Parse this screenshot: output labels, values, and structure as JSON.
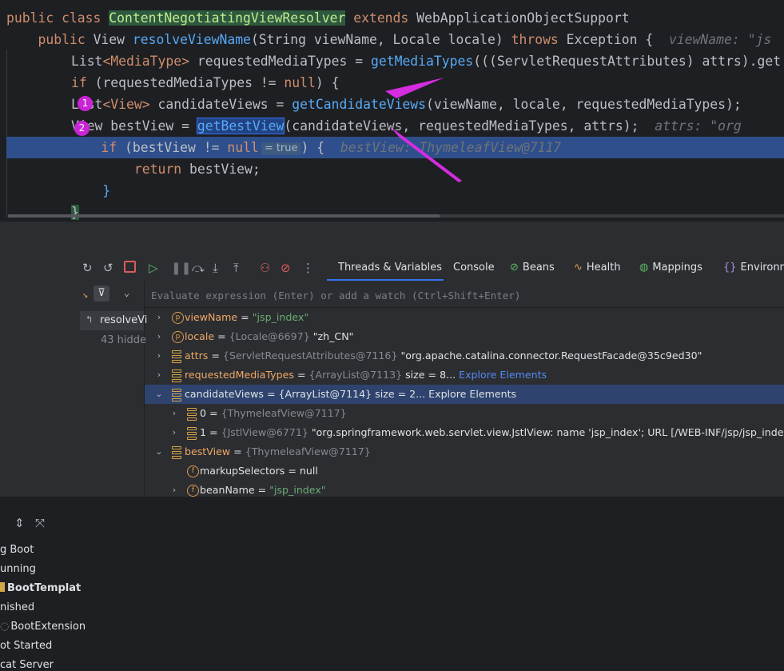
{
  "editor": {
    "line1": {
      "kw1": "public class ",
      "cls": "ContentNegotiatingViewResolver",
      "kw2": " extends ",
      "rest": "WebApplicationObjectSupport"
    },
    "line2": {
      "indent": "    ",
      "kw1": "public ",
      "type": "View ",
      "fn": "resolveViewName",
      "params": "(String viewName, Locale locale) ",
      "kw2": "throws ",
      "rest": "Exception { ",
      "hint": " viewName: \"js"
    },
    "line3": {
      "indent": "        ",
      "a": "List",
      "b": "<MediaType>",
      "c": " requestedMediaTypes = ",
      "call": "getMediaTypes",
      "d": "(((ServletRequestAttributes) attrs).get"
    },
    "line4": {
      "indent": "        ",
      "kw": "if",
      "a": " (requestedMediaTypes != ",
      "nul": "null",
      "b": ") {"
    },
    "line5": {
      "indent": "        ",
      "a": "List",
      "b": "<View>",
      "c": " candidateViews = ",
      "call": "getCandidateViews",
      "d": "(viewName, locale, requestedMediaTypes);"
    },
    "line6": {
      "indent": "        ",
      "a": "View bestView = ",
      "call": "getBestView",
      "d": "(candidateViews, requestedMediaTypes, attrs);  ",
      "hint": "attrs: \"org"
    },
    "line7": {
      "indent": "            ",
      "kw": "if",
      "a": " (bestView != ",
      "nul": "null",
      "badge": "= true",
      "b": ") {  ",
      "hint": "bestView: ThymeleafView@7117"
    },
    "line8": {
      "indent": "                ",
      "kw": "return",
      "a": " bestView;"
    },
    "line9": {
      "indent": "            ",
      "a": "}"
    },
    "line10": {
      "indent": "        ",
      "a": "}"
    },
    "markers": [
      "1",
      "2"
    ]
  },
  "toolbar": {
    "tabs": [
      {
        "label": "Threads & Variables"
      },
      {
        "label": "Console"
      },
      {
        "label": "Beans"
      },
      {
        "label": "Health"
      },
      {
        "label": "Mappings"
      },
      {
        "label": "Environme"
      }
    ],
    "more": "⋮"
  },
  "sessions": [
    {
      "label": "g Boot"
    },
    {
      "label": "unning"
    },
    {
      "label": "BootTemplat"
    },
    {
      "label": "nished"
    },
    {
      "label": "BootExtension"
    },
    {
      "label": "ot Started"
    },
    {
      "label": "cat Server"
    }
  ],
  "frames": {
    "current": "resolveVi",
    "hidden": "43 hidde"
  },
  "evaluate": {
    "placeholder": "Evaluate expression (Enter) or add a watch (Ctrl+Shift+Enter)"
  },
  "variables": [
    {
      "name": "viewName",
      "op": " = ",
      "value": "\"jsp_index\""
    },
    {
      "name": "locale",
      "op": " = ",
      "meta": "{Locale@6697}",
      "value": " \"zh_CN\""
    },
    {
      "name": "attrs",
      "op": " = ",
      "meta": "{ServletRequestAttributes@7116}",
      "value": " \"org.apache.catalina.connector.RequestFacade@35c9ed30\""
    },
    {
      "name": "requestedMediaTypes",
      "op": " = ",
      "meta": "{ArrayList@7113}",
      "value": "  size = 8... ",
      "link": "Explore Elements"
    },
    {
      "name": "candidateViews",
      "op": " = ",
      "meta": "{ArrayList@7114}",
      "value": "  size = 2... ",
      "link": "Explore Elements"
    },
    {
      "name": "0",
      "op": " = ",
      "meta": "{ThymeleafView@7117}"
    },
    {
      "name": "1",
      "op": " = ",
      "meta": "{JstlView@6771}",
      "value": " \"org.springframework.web.servlet.view.JstlView: name 'jsp_index'; URL [/WEB-INF/jsp/jsp_index.jsp]\""
    },
    {
      "name": "bestView",
      "op": " = ",
      "meta": "{ThymeleafView@7117}"
    },
    {
      "name": "markupSelectors",
      "op": " = ",
      "value": "null"
    },
    {
      "name": "beanName",
      "op": " = ",
      "value": "\"jsp_index\""
    }
  ],
  "colors": {
    "accent": "#3574f0",
    "arrow": "#d52ce0",
    "exec_line": "#2e4f8c"
  }
}
